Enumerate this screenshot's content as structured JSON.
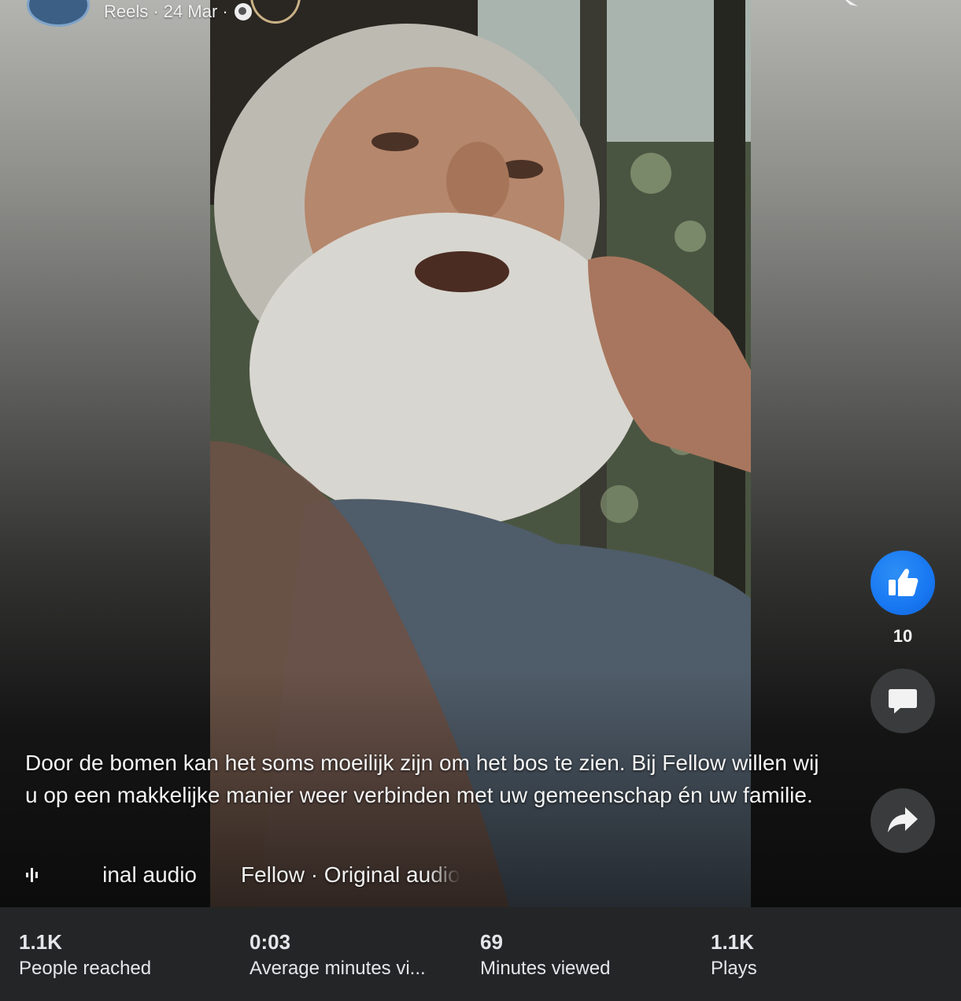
{
  "header": {
    "meta_text": "Reels · 24 Mar ·",
    "privacy_icon": "globe-icon"
  },
  "actions": {
    "like_count": "10",
    "like_icon": "thumbs-up-icon",
    "comment_icon": "comment-icon",
    "share_icon": "share-icon",
    "accent_color": "#1877f2"
  },
  "caption": {
    "text": "Door de bomen kan het soms moeilijk zijn om het bos te zien. Bij Fellow willen wij u op een makkelijke manier weer verbinden met uw gemeenschap én uw familie."
  },
  "audio": {
    "icon": "audio-waveform-icon",
    "faded_text": "inal audio",
    "text": "Fellow · Original audio"
  },
  "stats": [
    {
      "value": "1.1K",
      "label": "People reached"
    },
    {
      "value": "0:03",
      "label": "Average minutes vi..."
    },
    {
      "value": "69",
      "label": "Minutes viewed"
    },
    {
      "value": "1.1K",
      "label": "Plays"
    }
  ]
}
